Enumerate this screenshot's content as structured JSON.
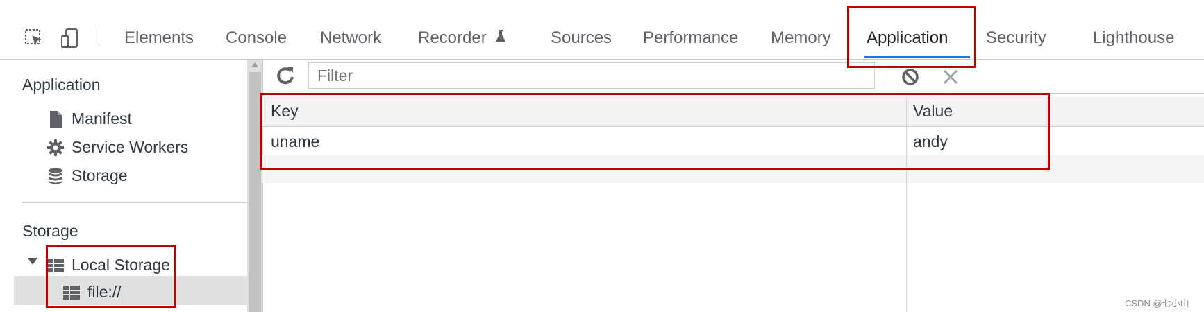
{
  "toolbar": {
    "tabs": [
      {
        "label": "Elements"
      },
      {
        "label": "Console"
      },
      {
        "label": "Network"
      },
      {
        "label": "Recorder"
      },
      {
        "label": "Sources"
      },
      {
        "label": "Performance"
      },
      {
        "label": "Memory"
      },
      {
        "label": "Application",
        "active": true
      },
      {
        "label": "Security"
      },
      {
        "label": "Lighthouse"
      }
    ],
    "recorder_badge_icon": "flask-icon"
  },
  "sidebar": {
    "application_title": "Application",
    "application_items": [
      {
        "label": "Manifest",
        "icon": "document-icon"
      },
      {
        "label": "Service Workers",
        "icon": "gear-icon"
      },
      {
        "label": "Storage",
        "icon": "database-icon"
      }
    ],
    "storage_title": "Storage",
    "local_storage_label": "Local Storage",
    "local_storage_child": "file://"
  },
  "filter": {
    "placeholder": "Filter"
  },
  "table": {
    "columns": [
      "Key",
      "Value"
    ],
    "rows": [
      {
        "key": "uname",
        "value": "andy"
      }
    ]
  },
  "watermark": "CSDN @七小山",
  "colors": {
    "highlight_box": "#c00000",
    "active_tab_underline": "#1a73e8"
  }
}
